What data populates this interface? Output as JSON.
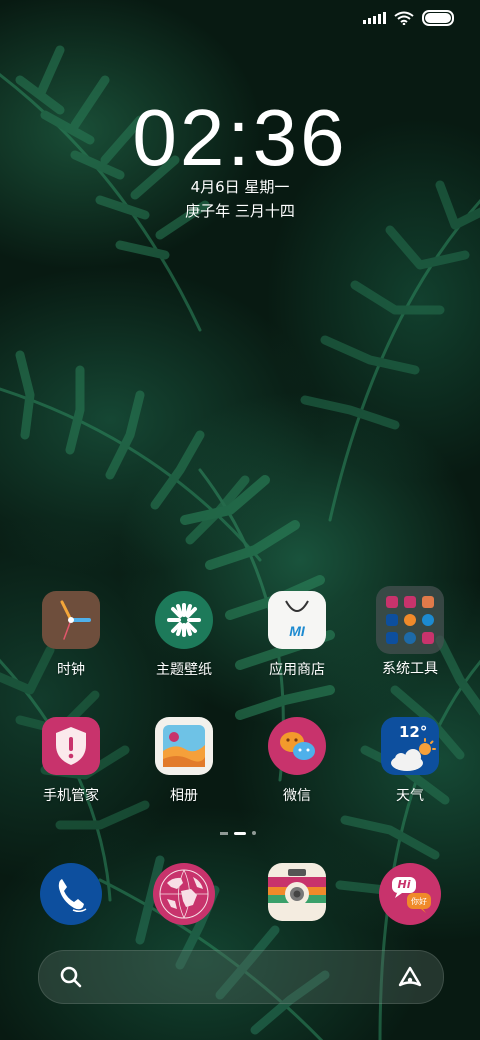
{
  "status": {
    "signal_icon": "signal-icon",
    "wifi_icon": "wifi-icon",
    "battery_icon": "battery-icon"
  },
  "clock": {
    "time": "02:36",
    "date": "4月6日 星期一",
    "lunar": "庚子年 三月十四"
  },
  "apps_row1": [
    {
      "label": "时钟",
      "icon": "clock-icon"
    },
    {
      "label": "主题壁纸",
      "icon": "themes-icon"
    },
    {
      "label": "应用商店",
      "icon": "app-store-icon"
    },
    {
      "label": "系统工具",
      "icon": "folder-icon"
    }
  ],
  "apps_row2": [
    {
      "label": "手机管家",
      "icon": "security-shield-icon"
    },
    {
      "label": "相册",
      "icon": "gallery-icon"
    },
    {
      "label": "微信",
      "icon": "wechat-icon"
    },
    {
      "label": "天气",
      "icon": "weather-icon"
    }
  ],
  "weather": {
    "temp": "12°"
  },
  "store": {
    "logo_text": "MI"
  },
  "dock": [
    {
      "icon": "phone-icon"
    },
    {
      "icon": "browser-globe-icon"
    },
    {
      "icon": "camera-icon"
    },
    {
      "icon": "messages-icon"
    }
  ],
  "messages_icon": {
    "bubble_text_1": "Hi",
    "bubble_text_2": "你好"
  },
  "page_indicator": {
    "pages": 3,
    "current": 2
  },
  "search": {
    "search_icon": "search-icon",
    "assistant_icon": "assistant-icon"
  },
  "colors": {
    "accent_pink": "#c8336c",
    "accent_blue": "#0d4f9e",
    "wallpaper_green": "#1d6a4a"
  }
}
